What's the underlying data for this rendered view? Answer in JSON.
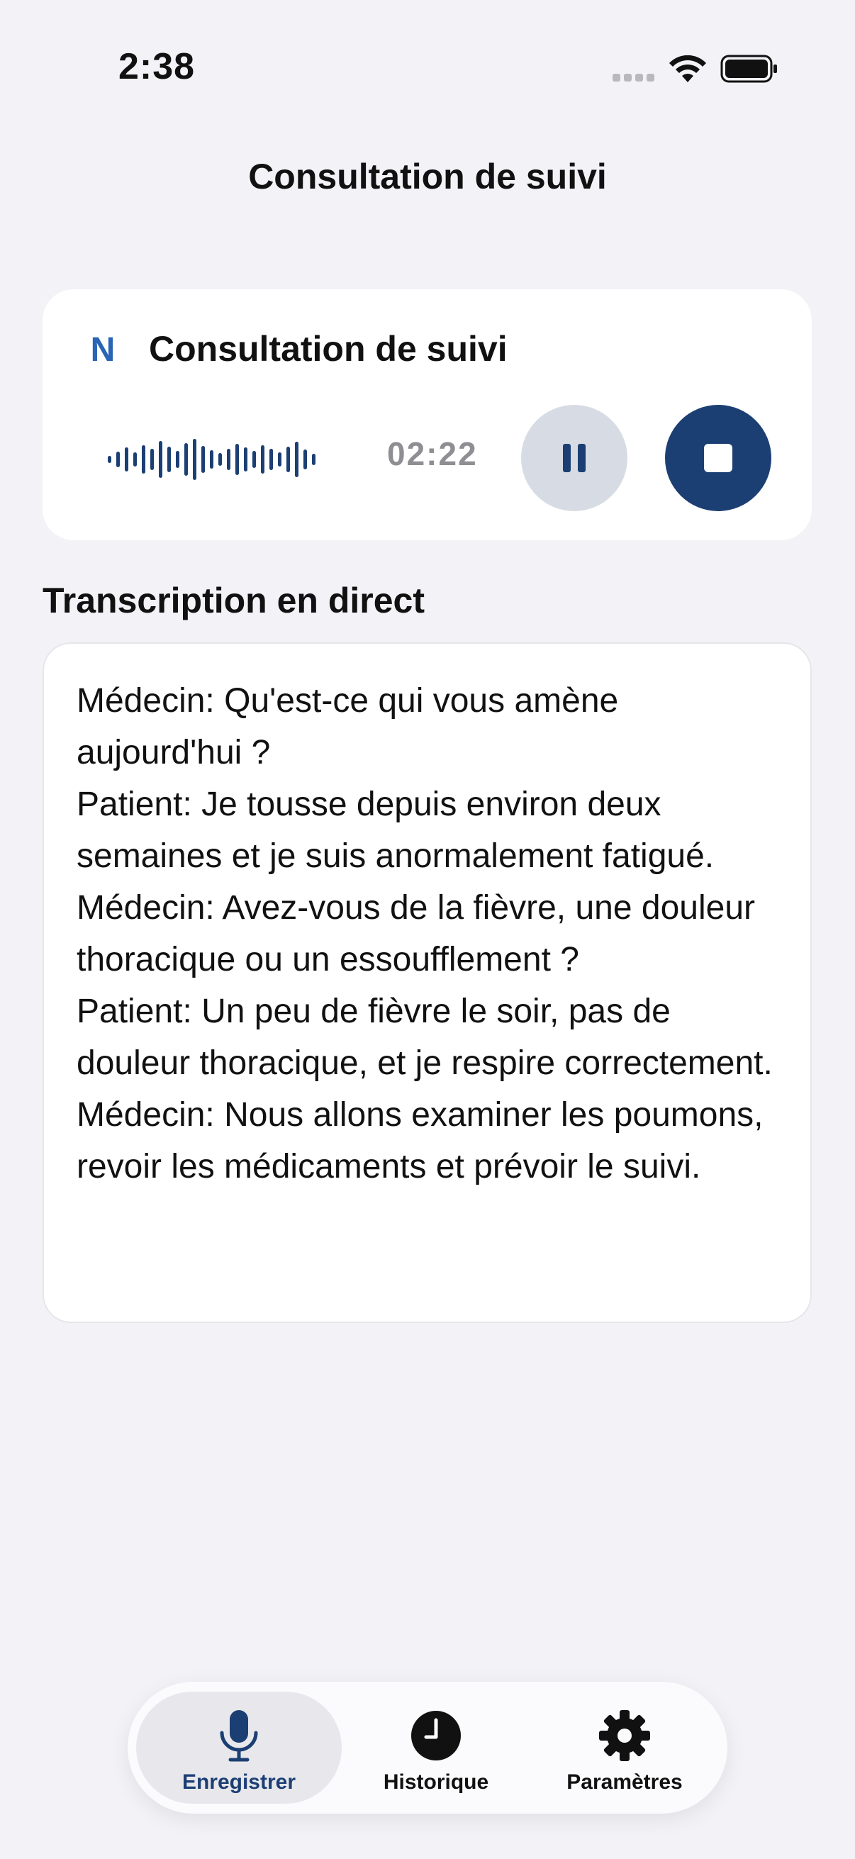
{
  "status_bar": {
    "time": "2:38"
  },
  "header": {
    "title": "Consultation de suivi"
  },
  "recording_card": {
    "brand_letter": "N",
    "title": "Consultation de suivi",
    "timer": "02:22",
    "pause_icon": "pause-icon",
    "stop_icon": "stop-icon",
    "accent_color": "#1c3f73",
    "brand_color": "#2a64b5"
  },
  "transcription": {
    "section_title": "Transcription en direct",
    "lines": [
      "Médecin: Qu'est-ce qui vous amène aujourd'hui ?",
      "Patient: Je tousse depuis environ deux semaines et je suis anormalement fatigué.",
      "Médecin: Avez-vous de la fièvre, une douleur thoracique ou un essoufflement ?",
      "Patient: Un peu de fièvre le soir, pas de douleur thoracique, et je respire correctement.",
      "Médecin: Nous allons examiner les poumons, revoir les médicaments et prévoir le suivi."
    ]
  },
  "tab_bar": {
    "items": [
      {
        "label": "Enregistrer",
        "icon": "microphone-icon",
        "active": true
      },
      {
        "label": "Historique",
        "icon": "clock-icon",
        "active": false
      },
      {
        "label": "Paramètres",
        "icon": "gear-icon",
        "active": false
      }
    ]
  }
}
